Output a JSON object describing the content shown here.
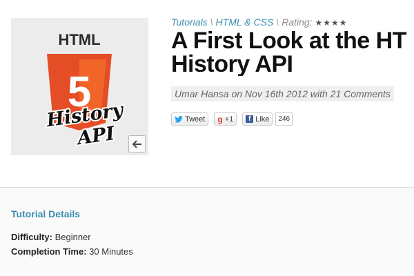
{
  "thumbnail": {
    "html_text": "HTML",
    "shield_number": "5",
    "overlay_line1": "History",
    "overlay_line2": "API"
  },
  "breadcrumb": {
    "items": [
      "Tutorials",
      "HTML & CSS"
    ],
    "rating_label": "Rating:",
    "rating_stars": 4
  },
  "article": {
    "title_line1": "A First Look at the HT",
    "title_line2": "History API",
    "byline": "Umar Hansa on Nov 16th 2012 with 21 Comments"
  },
  "social": {
    "tweet_label": "Tweet",
    "gplus_label": "+1",
    "like_label": "Like",
    "like_count": "246"
  },
  "details": {
    "heading": "Tutorial Details",
    "difficulty_label": "Difficulty:",
    "difficulty_value": "Beginner",
    "time_label": "Completion Time:",
    "time_value": "30 Minutes"
  },
  "colors": {
    "link": "#3a8fb0",
    "html5_orange": "#e44d26",
    "facebook": "#3b5998",
    "twitter": "#2aa3ef"
  }
}
